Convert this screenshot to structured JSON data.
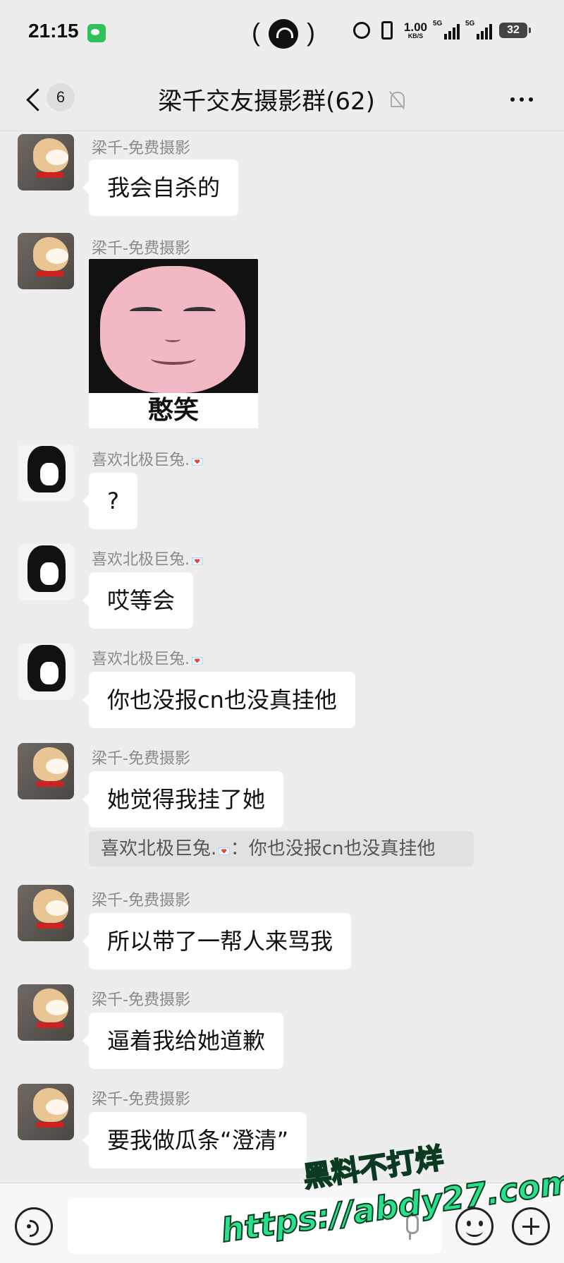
{
  "status_bar": {
    "time": "21:15",
    "net_speed_value": "1.00",
    "net_speed_unit": "KB/S",
    "signal_1_label": "5G",
    "signal_2_label": "5G",
    "battery": "32",
    "hotspot_left": "(",
    "hotspot_right": ")"
  },
  "nav": {
    "unread_count": "6",
    "title": "梁千交友摄影群(62)"
  },
  "messages": [
    {
      "sender": "梁千-免费摄影",
      "text": "我会自杀的",
      "avatar": "dog-avatar"
    },
    {
      "sender": "梁千-免费摄影",
      "sticker_caption": "憨笑",
      "avatar": "dog-avatar"
    },
    {
      "sender": "喜欢北极巨兔.",
      "sender_emoji": "💌",
      "text": "?",
      "avatar": "girl-avatar"
    },
    {
      "sender": "喜欢北极巨兔.",
      "sender_emoji": "💌",
      "text": "哎等会",
      "avatar": "girl-avatar"
    },
    {
      "sender": "喜欢北极巨兔.",
      "sender_emoji": "💌",
      "text": "你也没报cn也没真挂他",
      "avatar": "girl-avatar"
    },
    {
      "sender": "梁千-免费摄影",
      "text": "她觉得我挂了她",
      "avatar": "dog-avatar"
    },
    {
      "sender": "梁千-免费摄影",
      "text": "所以带了一帮人来骂我",
      "avatar": "dog-avatar"
    },
    {
      "sender": "梁千-免费摄影",
      "text": "逼着我给她道歉",
      "avatar": "dog-avatar"
    },
    {
      "sender": "梁千-免费摄影",
      "text": "要我做瓜条“澄清”",
      "avatar": "dog-avatar"
    }
  ],
  "quote": {
    "sender": "喜欢北极巨兔.",
    "sender_emoji": "💌",
    "separator": "：",
    "text": "你也没报cn也没真挂他"
  },
  "watermark": {
    "top": "黑料不打烊",
    "url": "https://abdy27.com"
  },
  "colors": {
    "background": "#ededed",
    "bubble": "#ffffff",
    "heart": "#e0324a",
    "watermark_green": "#29e08c"
  }
}
